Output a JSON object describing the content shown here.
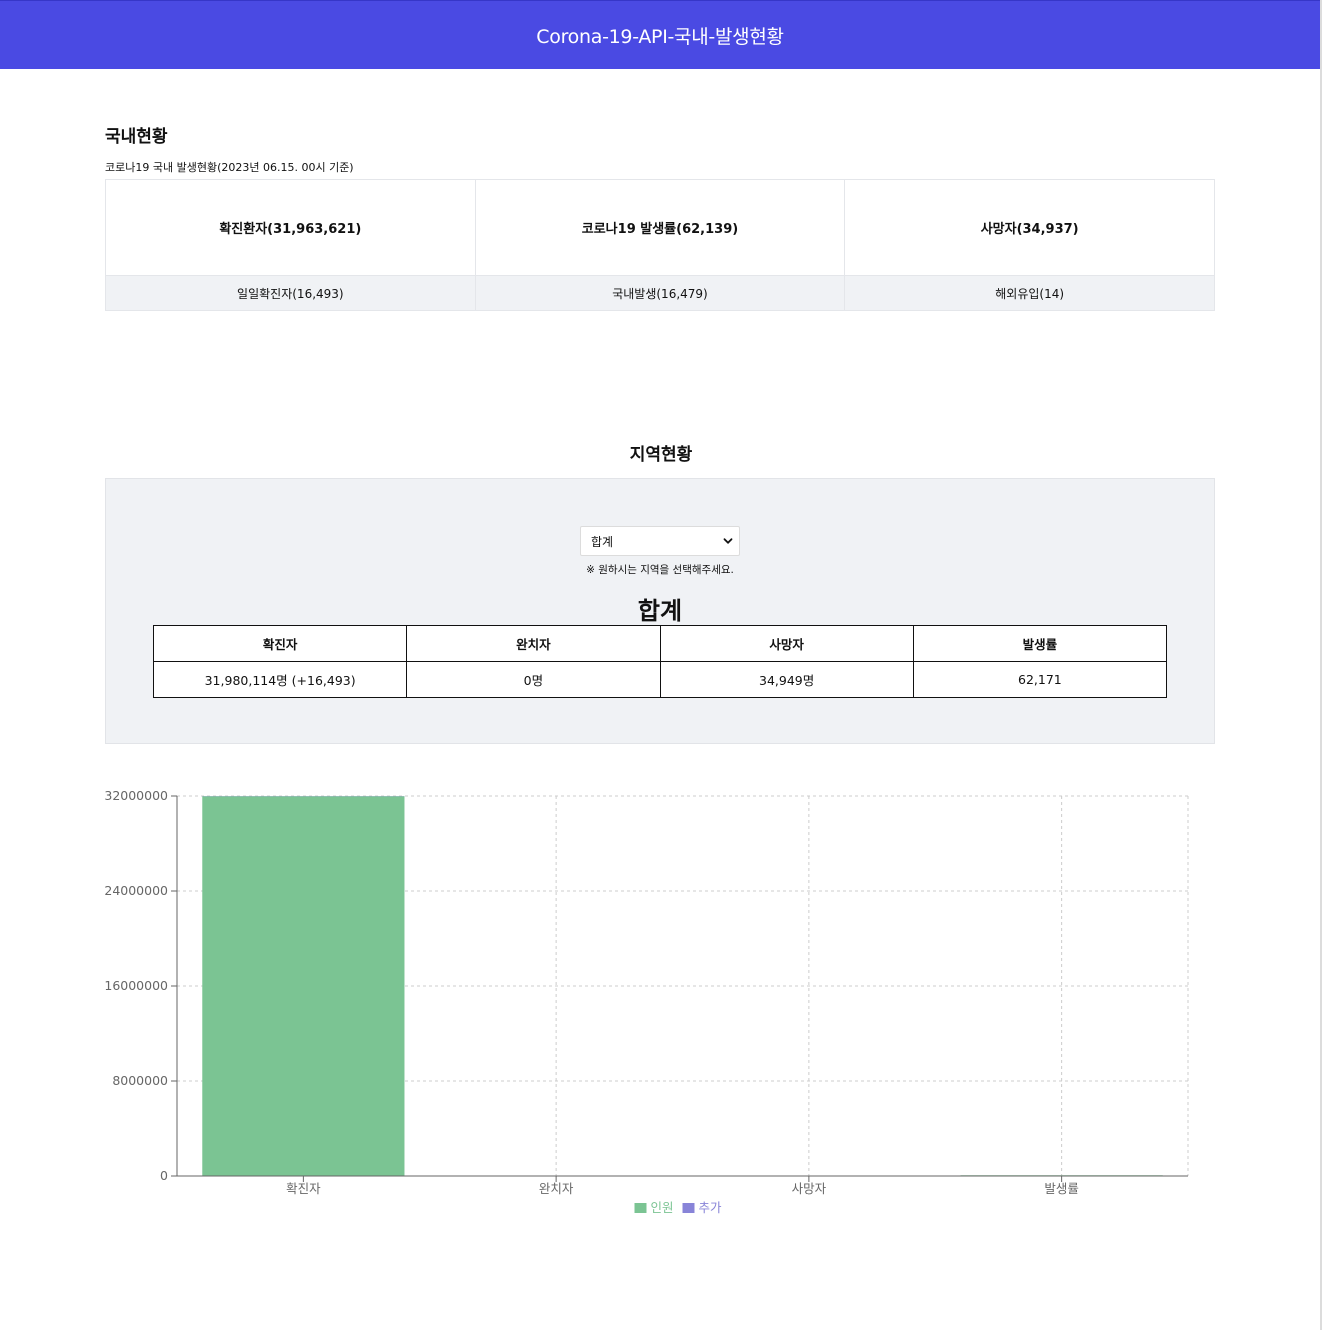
{
  "header": {
    "title": "Corona-19-API-국내-발생현황"
  },
  "domestic": {
    "heading": "국내현황",
    "caption": "코로나19 국내 발생현황(2023년 06.15. 00시 기준)",
    "top_cells": [
      "확진환자(31,963,621)",
      "코로나19 발생률(62,139)",
      "사망자(34,937)"
    ],
    "bottom_cells": [
      "일일확진자(16,493)",
      "국내발생(16,479)",
      "해외유입(14)"
    ]
  },
  "region": {
    "heading": "지역현황",
    "select_value": "합계",
    "hint": "※ 원하시는 지역을 선택해주세요.",
    "title": "합계",
    "table": {
      "headers": [
        "확진자",
        "완치자",
        "사망자",
        "발생률"
      ],
      "values": [
        "31,980,114명 (+16,493)",
        "0명",
        "34,949명",
        "62,171"
      ]
    }
  },
  "colors": {
    "header_bg": "#4a4ae3",
    "series_people": "#7bc493",
    "series_added": "#8884d8"
  },
  "chart_data": {
    "type": "bar",
    "categories": [
      "확진자",
      "완치자",
      "사망자",
      "발생률"
    ],
    "series": [
      {
        "name": "인원",
        "values": [
          31980114,
          0,
          34949,
          62171
        ],
        "color": "#7bc493"
      },
      {
        "name": "추가",
        "values": [
          16493,
          0,
          0,
          0
        ],
        "color": "#8884d8"
      }
    ],
    "stacked": true,
    "ylim": [
      0,
      32000000
    ],
    "yticks": [
      0,
      8000000,
      16000000,
      24000000,
      32000000
    ],
    "grid": true,
    "legend": "bottom-center"
  }
}
